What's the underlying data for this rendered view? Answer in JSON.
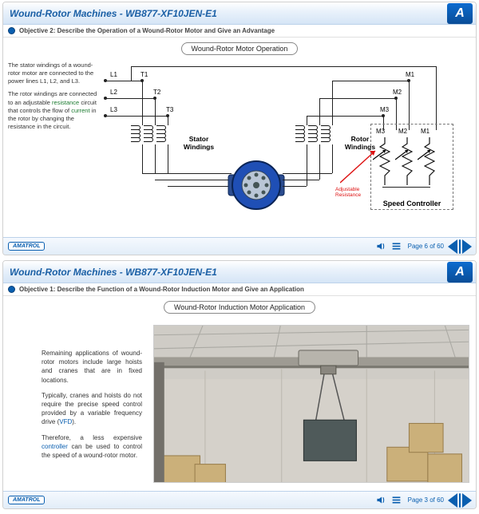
{
  "course_title": "Wound-Rotor Machines - WB877-XF10JEN-E1",
  "brand_short": "AMATROL",
  "logo_letter": "A",
  "slide1": {
    "objective": "Objective 2: Describe the Operation of a Wound-Rotor Motor and Give an Advantage",
    "diagram_title": "Wound-Rotor Motor Operation",
    "para1": "The stator windings of a wound-rotor motor are connected to the power lines L1, L2, and L3.",
    "para2_a": "The rotor windings are connected to an adjustable ",
    "para2_kw1": "resistance",
    "para2_b": " circuit that controls the flow of ",
    "para2_kw2": "current",
    "para2_c": " in the rotor by changing the resistance in the circuit.",
    "labels": {
      "L1": "L1",
      "L2": "L2",
      "L3": "L3",
      "T1": "T1",
      "T2": "T2",
      "T3": "T3",
      "M1": "M1",
      "M2": "M2",
      "M3": "M3",
      "M3b": "M3",
      "M2b": "M2",
      "M1b": "M1",
      "stator": "Stator Windings",
      "rotor": "Rotor Windings",
      "adj": "Adjustable Resistance",
      "speed": "Speed Controller"
    },
    "page": "Page 6 of 60"
  },
  "slide2": {
    "objective": "Objective 1: Describe the Function of a Wound-Rotor Induction Motor and Give an Application",
    "diagram_title": "Wound-Rotor Induction Motor Application",
    "para1": "Remaining applications of wound-rotor motors include large hoists and cranes that are in fixed locations.",
    "para2_a": "Typically, cranes and hoists do not require the precise speed control provided by a variable frequency drive (",
    "para2_link": "VFD",
    "para2_b": ").",
    "para3_a": "Therefore, a less expensive ",
    "para3_link": "controller",
    "para3_b": " can be used to control the speed of a wound-rotor motor.",
    "page": "Page 3 of 60"
  },
  "icons": {
    "audio": "audio-icon",
    "menu": "menu-icon"
  }
}
